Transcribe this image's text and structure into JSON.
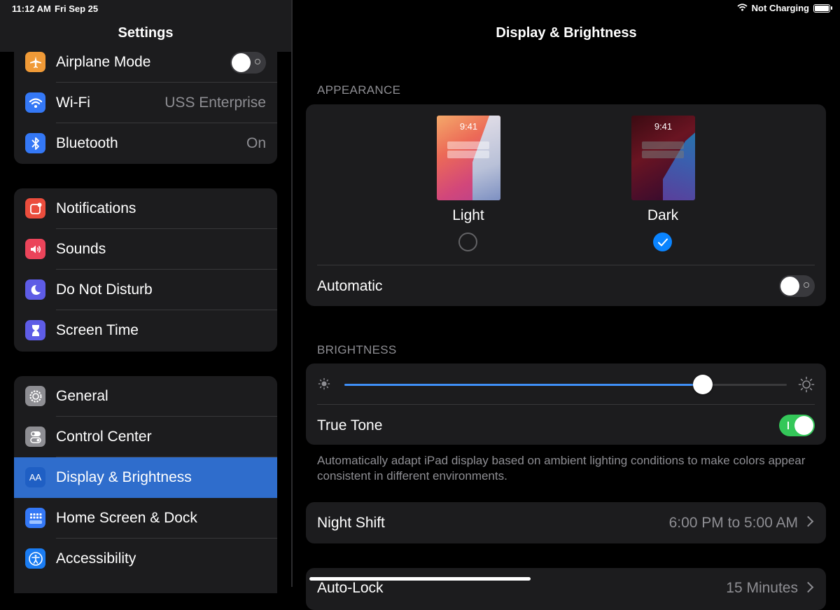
{
  "status": {
    "time": "11:12 AM",
    "date": "Fri Sep 25",
    "charging": "Not Charging"
  },
  "sidebar": {
    "title": "Settings",
    "group1": [
      {
        "label": "Airplane Mode",
        "value": "",
        "color": "#f09a37"
      },
      {
        "label": "Wi-Fi",
        "value": "USS Enterprise",
        "color": "#3478f6"
      },
      {
        "label": "Bluetooth",
        "value": "On",
        "color": "#3478f6"
      }
    ],
    "group2": [
      {
        "label": "Notifications",
        "color": "#eb4d3d"
      },
      {
        "label": "Sounds",
        "color": "#eb445a"
      },
      {
        "label": "Do Not Disturb",
        "color": "#5e5ce6"
      },
      {
        "label": "Screen Time",
        "color": "#5e5ce6"
      }
    ],
    "group3": [
      {
        "label": "General",
        "color": "#8e8e93"
      },
      {
        "label": "Control Center",
        "color": "#8e8e93"
      },
      {
        "label": "Display & Brightness",
        "color": "#2f6dcc",
        "selected": true
      },
      {
        "label": "Home Screen & Dock",
        "color": "#3478f6"
      },
      {
        "label": "Accessibility",
        "color": "#1a7cf2"
      }
    ]
  },
  "main": {
    "title": "Display & Brightness",
    "appearance": {
      "heading": "APPEARANCE",
      "preview_time": "9:41",
      "light_label": "Light",
      "dark_label": "Dark",
      "selected": "Dark",
      "automatic_label": "Automatic",
      "automatic_on": false
    },
    "brightness": {
      "heading": "BRIGHTNESS",
      "level": 0.81,
      "true_tone_label": "True Tone",
      "true_tone_on": true,
      "footnote": "Automatically adapt iPad display based on ambient lighting conditions to make colors appear consistent in different environments."
    },
    "night_shift": {
      "label": "Night Shift",
      "value": "6:00 PM to 5:00 AM"
    },
    "auto_lock": {
      "label": "Auto-Lock",
      "value": "15 Minutes"
    }
  }
}
